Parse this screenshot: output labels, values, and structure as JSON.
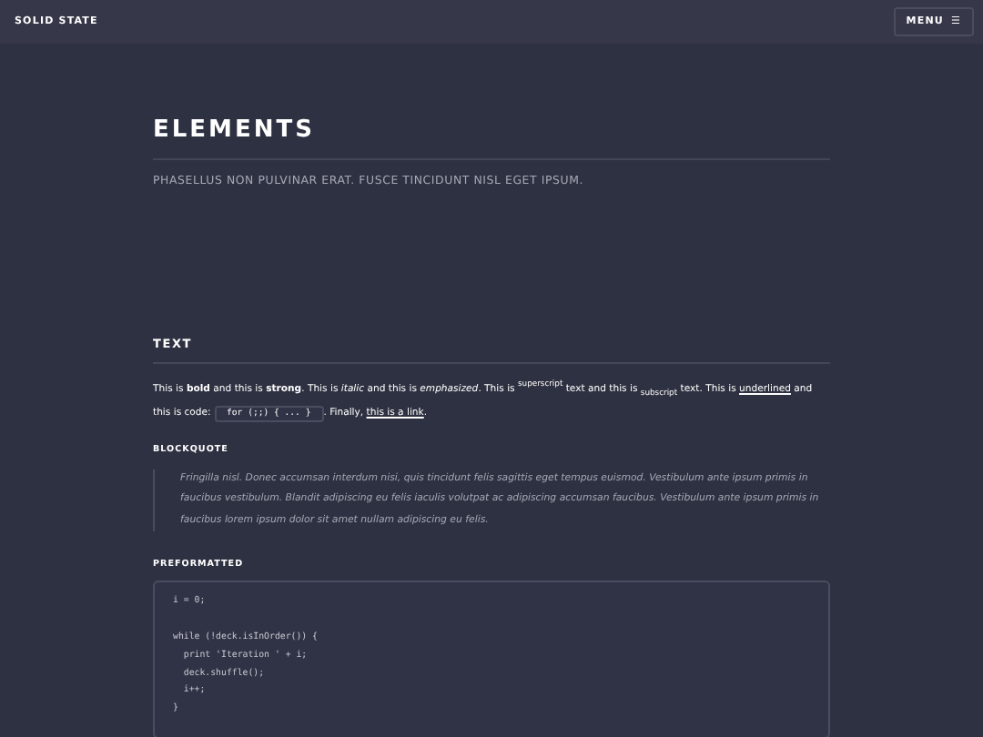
{
  "header": {
    "brand": "SOLID STATE",
    "menu": {
      "label": "MENU",
      "icon": "☰"
    }
  },
  "page": {
    "title": "ELEMENTS",
    "subtitle": "PHASELLUS NON PULVINAR ERAT. FUSCE TINCIDUNT NISL EGET IPSUM."
  },
  "text_section": {
    "heading": "TEXT",
    "paragraph": {
      "before": "This is **bold** and this is **strong**. This is *italic* and this is *emphasized*. This is $^{superscript}$ text and this is $_{subscript}$ text. This is",
      "underlined": "underlined",
      "middle": "and this is code:",
      "code": "for (;;) { ... }",
      "after": ". Finally,",
      "link": "this is a link",
      "end": "."
    }
  },
  "blockquote": {
    "heading": "BLOCKQUOTE",
    "text": "Fringilla nisl. Donec accumsan interdum nisi, quis tincidunt felis sagittis eget tempus euismod. Vestibulum ante ipsum primis in faucibus vestibulum. Blandit adipiscing eu felis iaculis volutpat ac adipiscing accumsan faucibus. Vestibulum ante ipsum primis in faucibus lorem ipsum dolor sit amet nullam adipiscing eu felis."
  },
  "preformatted": {
    "heading": "PREFORMATTED",
    "blocks": [
      [
        "i = 0;"
      ],
      [
        "while (!deck.isInOrder()) {",
        "  print 'Iteration ' + i;",
        "  deck.shuffle();",
        "  i++;",
        "}"
      ]
    ]
  }
}
